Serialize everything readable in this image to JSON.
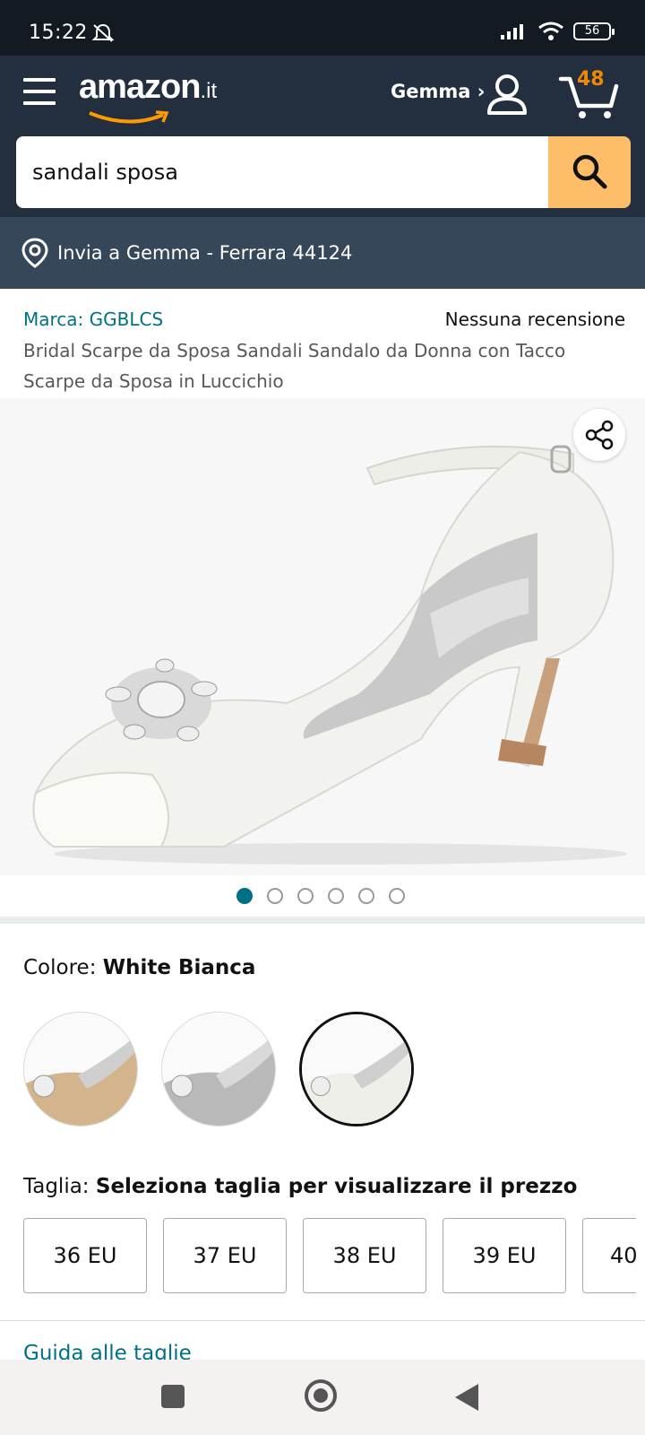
{
  "status": {
    "time": "15:22",
    "battery": "56"
  },
  "header": {
    "logo_word": "amazon",
    "logo_tld": ".it",
    "account_label": "Gemma ›",
    "cart_count": "48"
  },
  "search": {
    "value": "sandali sposa",
    "placeholder": ""
  },
  "delivery": {
    "text": "Invia a Gemma - Ferrara 44124"
  },
  "product": {
    "brand": "Marca: GGBLCS",
    "reviews": "Nessuna recensione",
    "title": "Bridal Scarpe da Sposa Sandali Sandalo da Donna con Tacco Scarpe da Sposa in Luccichio",
    "image_count": 6,
    "active_image": 1
  },
  "color": {
    "label": "Colore: ",
    "selected": "White Bianca",
    "swatches": [
      "champagne-shoe",
      "silver-shoe",
      "white-shoe"
    ]
  },
  "size": {
    "label": "Taglia: ",
    "prompt": "Seleziona taglia per visualizzare il prezzo",
    "options": [
      "36 EU",
      "37 EU",
      "38 EU",
      "39 EU",
      "40"
    ]
  },
  "size_guide": "Guida alle taglie",
  "colors": {
    "header": "#232f3e",
    "deliver": "#37475a",
    "search_btn": "#febd69",
    "link": "#007185",
    "cart": "#f08804"
  }
}
